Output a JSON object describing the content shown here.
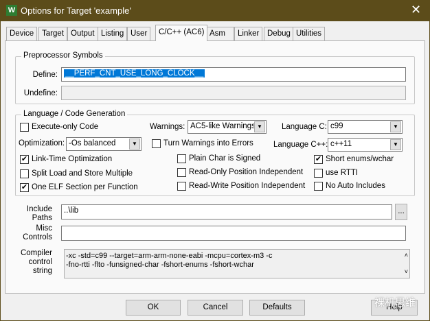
{
  "window": {
    "title": "Options for Target 'example'",
    "app_icon": "W",
    "close_icon": "✕"
  },
  "tabs": [
    "Device",
    "Target",
    "Output",
    "Listing",
    "User",
    "C/C++ (AC6)",
    "Asm",
    "Linker",
    "Debug",
    "Utilities"
  ],
  "active_tab": "C/C++ (AC6)",
  "preprocessor": {
    "group_label": "Preprocessor Symbols",
    "define_label": "Define:",
    "define_value": "__PERF_CNT_USE_LONG_CLOCK__",
    "undefine_label": "Undefine:",
    "undefine_value": ""
  },
  "language": {
    "group_label": "Language / Code Generation",
    "execute_only": {
      "label": "Execute-only Code",
      "checked": false
    },
    "optimization_label": "Optimization:",
    "optimization_value": "-Os balanced",
    "link_time": {
      "label": "Link-Time Optimization",
      "checked": true
    },
    "split_load": {
      "label": "Split Load and Store Multiple",
      "checked": false
    },
    "one_elf": {
      "label": "One ELF Section per Function",
      "checked": true
    },
    "warnings_label": "Warnings:",
    "warnings_value": "AC5-like Warnings",
    "turn_warnings": {
      "label": "Turn Warnings into Errors",
      "checked": false
    },
    "plain_char": {
      "label": "Plain Char is Signed",
      "checked": false
    },
    "ropi": {
      "label": "Read-Only Position Independent",
      "checked": false
    },
    "rwpi": {
      "label": "Read-Write Position Independent",
      "checked": false
    },
    "language_c_label": "Language C:",
    "language_c_value": "c99",
    "language_cpp_label": "Language C++:",
    "language_cpp_value": "c++11",
    "short_enums": {
      "label": "Short enums/wchar",
      "checked": true
    },
    "rtti": {
      "label": "use RTTI",
      "checked": false
    },
    "no_auto": {
      "label": "No Auto Includes",
      "checked": false
    }
  },
  "include": {
    "label1": "Include",
    "label2": "Paths",
    "value": "..\\lib",
    "browse": "..."
  },
  "misc": {
    "label1": "Misc",
    "label2": "Controls",
    "value": ""
  },
  "compiler": {
    "label1": "Compiler",
    "label2": "control",
    "label3": "string",
    "line1": "-xc -std=c99 --target=arm-arm-none-eabi -mcpu=cortex-m3 -c",
    "line2": "-fno-rtti -flto -funsigned-char -fshort-enums -fshort-wchar"
  },
  "buttons": {
    "ok": "OK",
    "cancel": "Cancel",
    "defaults": "Defaults",
    "help": "Help"
  },
  "watermark": "裸机思维"
}
